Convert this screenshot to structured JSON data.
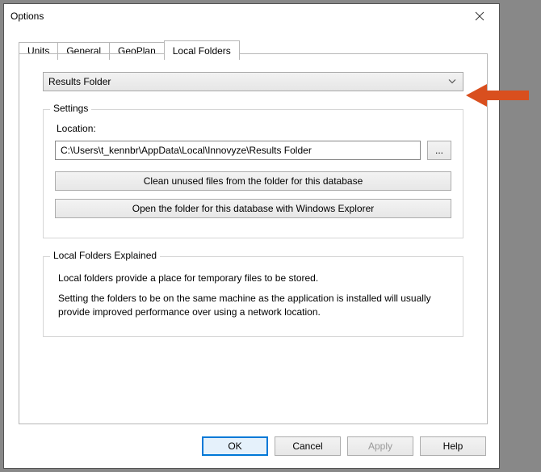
{
  "window": {
    "title": "Options"
  },
  "tabs": [
    {
      "label": "Units"
    },
    {
      "label": "General"
    },
    {
      "label": "GeoPlan"
    },
    {
      "label": "Local Folders"
    }
  ],
  "dropdown": {
    "selected": "Results Folder"
  },
  "settings": {
    "legend": "Settings",
    "location_label": "Location:",
    "location_value": "C:\\Users\\t_kennbr\\AppData\\Local\\Innovyze\\Results Folder",
    "browse_label": "...",
    "clean_button": "Clean unused files from the folder for this database",
    "open_button": "Open the folder for this database with Windows Explorer"
  },
  "explained": {
    "legend": "Local Folders Explained",
    "p1": "Local folders provide a place for temporary files to be stored.",
    "p2": "Setting the folders to be on the same machine as the application is installed will usually provide improved performance over using a network location."
  },
  "footer": {
    "ok": "OK",
    "cancel": "Cancel",
    "apply": "Apply",
    "help": "Help"
  }
}
